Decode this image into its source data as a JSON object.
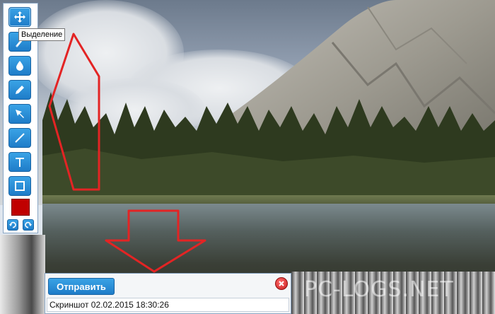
{
  "tooltip": {
    "text": "Выделение"
  },
  "toolbar": {
    "tools": [
      "move-icon",
      "marker-icon",
      "blur-drop-icon",
      "pencil-icon",
      "arrow-icon",
      "line-icon",
      "text-icon",
      "rectangle-icon"
    ],
    "active_color": "#c00000",
    "accent": "#1e7cc8"
  },
  "panel": {
    "send_label": "Отправить",
    "caption": "Скриншот 02.02.2015 18:30:26"
  },
  "watermark": "PC-LOGS.NET",
  "annotation_color": "#e32424"
}
